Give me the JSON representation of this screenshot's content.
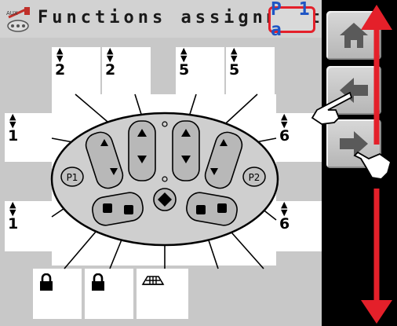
{
  "header": {
    "title": "Functions assignment",
    "page_code": "P 1 a",
    "logo_text": "AUX",
    "logo_icon": "aux-sprayer-icon"
  },
  "sidebar": {
    "buttons": [
      {
        "name": "home-button",
        "icon": "home-icon"
      },
      {
        "name": "previous-button",
        "icon": "arrow-left-icon"
      },
      {
        "name": "next-button",
        "icon": "arrow-right-icon"
      }
    ]
  },
  "assignments": {
    "top": [
      {
        "position": "top-1",
        "value": "2"
      },
      {
        "position": "top-2",
        "value": "2"
      },
      {
        "position": "top-3",
        "value": "5"
      },
      {
        "position": "top-4",
        "value": "5"
      }
    ],
    "left": [
      {
        "position": "left-upper",
        "value": "1"
      },
      {
        "position": "left-lower",
        "value": "1"
      }
    ],
    "right": [
      {
        "position": "right-upper",
        "value": "6"
      },
      {
        "position": "right-lower",
        "value": "6"
      }
    ],
    "bottom": [
      {
        "position": "bottom-1",
        "icon": "lock-icon"
      },
      {
        "position": "bottom-2",
        "icon": "lock-icon"
      },
      {
        "position": "bottom-3",
        "icon": "boom-icon"
      }
    ]
  },
  "joystick": {
    "left_button": "P1",
    "right_button": "P2"
  },
  "colors": {
    "accent_red": "#e4202a",
    "badge_text": "#1f55c4",
    "sidebar": "#000000",
    "background": "#c8c8c8"
  }
}
